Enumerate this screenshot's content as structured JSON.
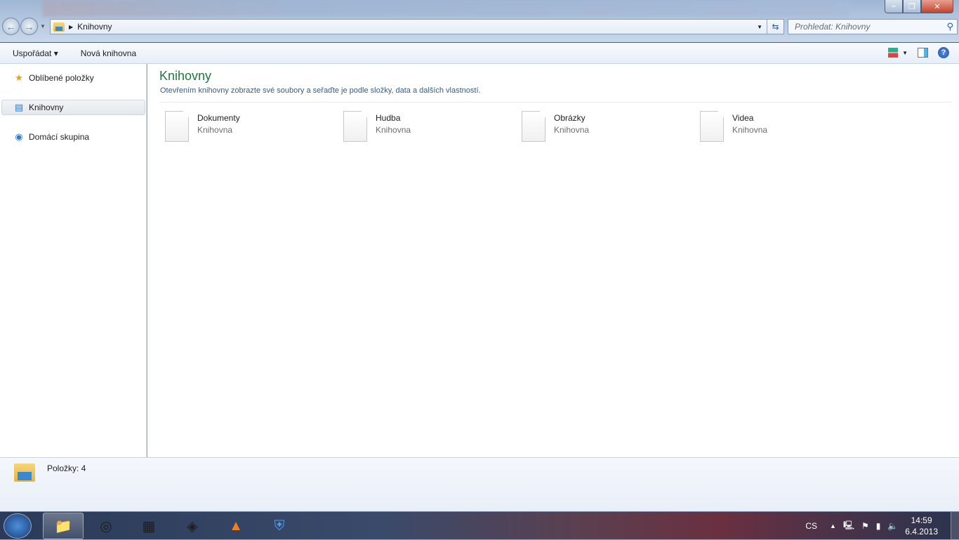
{
  "window": {
    "address": "Knihovny",
    "search_placeholder": "Prohledat: Knihovny"
  },
  "toolbar": {
    "organize": "Uspořádat ▾",
    "new_library": "Nová knihovna"
  },
  "sidebar": {
    "items": [
      {
        "label": "Oblíbené položky",
        "icon": "star-icon"
      },
      {
        "label": "Knihovny",
        "icon": "libraries-icon"
      },
      {
        "label": "Domácí skupina",
        "icon": "homegroup-icon"
      }
    ]
  },
  "main": {
    "title": "Knihovny",
    "subtitle": "Otevřením knihovny zobrazte své soubory a seřaďte je podle složky, data a dalších vlastností.",
    "libraries": [
      {
        "name": "Dokumenty",
        "type": "Knihovna"
      },
      {
        "name": "Hudba",
        "type": "Knihovna"
      },
      {
        "name": "Obrázky",
        "type": "Knihovna"
      },
      {
        "name": "Videa",
        "type": "Knihovna"
      }
    ]
  },
  "status": {
    "items": "Položky: 4"
  },
  "taskbar": {
    "lang": "CS",
    "time": "14:59",
    "date": "6.4.2013"
  },
  "colors": {
    "title": "#1e7a3c",
    "accent": "#1f5fb0"
  }
}
